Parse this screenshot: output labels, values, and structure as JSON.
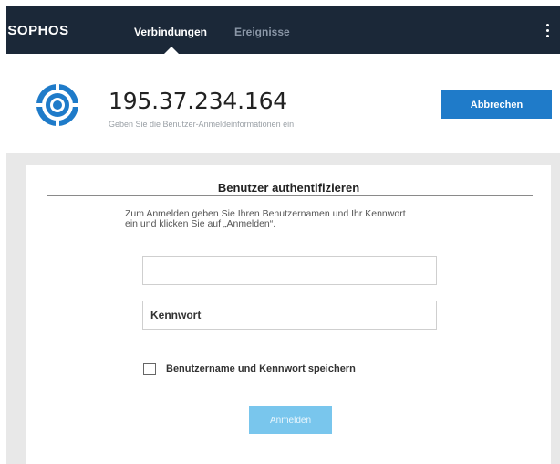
{
  "app": {
    "brand": "SOPHOS"
  },
  "nav": {
    "tabs": [
      {
        "label": "Verbindungen",
        "active": true
      },
      {
        "label": "Ereignisse",
        "active": false
      }
    ],
    "menu_icon": "vertical-ellipsis-icon"
  },
  "connection": {
    "logo_icon": "sophos-target-icon",
    "address": "195.37.234.164",
    "subtitle": "Geben Sie die Benutzer-Anmeldeinformationen ein",
    "cancel_label": "Abbrechen"
  },
  "auth": {
    "title": "Benutzer authentifizieren",
    "instructions_line1": "Zum Anmelden geben Sie Ihren Benutzernamen und Ihr Kennwort",
    "instructions_line2": "ein und klicken Sie auf „Anmelden“.",
    "username_value": "",
    "username_placeholder": "",
    "password_placeholder": "Kennwort",
    "remember_label": "Benutzername und Kennwort speichern",
    "remember_checked": false,
    "login_label": "Anmelden"
  },
  "colors": {
    "topbar": "#1b2838",
    "accent": "#1f7bc9",
    "login_disabled": "#79c6ed"
  }
}
